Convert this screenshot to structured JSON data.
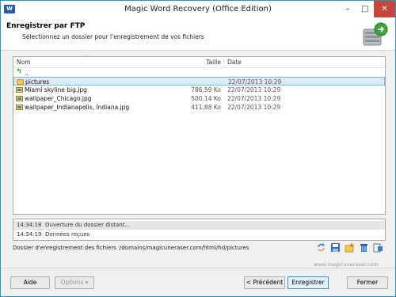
{
  "window": {
    "title": "Magic Word Recovery (Office Edition)",
    "app_icon_text": "W",
    "controls": {
      "minimize": "–",
      "maximize": "□",
      "close": "✕"
    },
    "close_color": "#c7463c"
  },
  "header": {
    "title": "Enregistrer par FTP",
    "subtitle": "Sélectionnez un dossier pour l'enregistrement de vos fichiers",
    "icon": "ftp-server-icon"
  },
  "file_list": {
    "columns": {
      "name": "Nom",
      "size": "Taille",
      "date": "Date"
    },
    "sort_indicator": "^",
    "rows": [
      {
        "icon": "parent-folder-icon",
        "name": "..",
        "size": "",
        "date": ""
      },
      {
        "icon": "folder-icon",
        "name": "pictures",
        "size": "",
        "date": "22/07/2013 10:29",
        "selected": true
      },
      {
        "icon": "image-file-icon",
        "name": "Miami skyline big.jpg",
        "size": "786,59 Ko",
        "date": "22/07/2013 10:29"
      },
      {
        "icon": "image-file-icon",
        "name": "wallpaper_Chicago.jpg",
        "size": "500,14 Ko",
        "date": "22/07/2013 10:29"
      },
      {
        "icon": "image-file-icon",
        "name": "wallpaper_Indianapolis, Indiana.jpg",
        "size": "411,88 Ko",
        "date": "22/07/2013 10:29"
      }
    ]
  },
  "log": [
    {
      "time": "14:34:18",
      "message": "Ouverture du dossier distant..."
    },
    {
      "time": "14:34:19",
      "message": "Données reçues"
    }
  ],
  "destination": {
    "label": "Dossier d'enregistrement des fichiers :",
    "path": "/domains/magicuneraser.com/html/hd/pictures"
  },
  "toolbar": [
    "refresh-icon",
    "save-icon",
    "new-folder-icon",
    "delete-icon",
    "properties-icon"
  ],
  "brand": "www.magicuneraser.com",
  "buttons": {
    "help": "Aide",
    "options": "Options",
    "options_arrow": "▾",
    "previous": "< Précédent",
    "save": "Enregistrer",
    "close": "Fermer"
  }
}
